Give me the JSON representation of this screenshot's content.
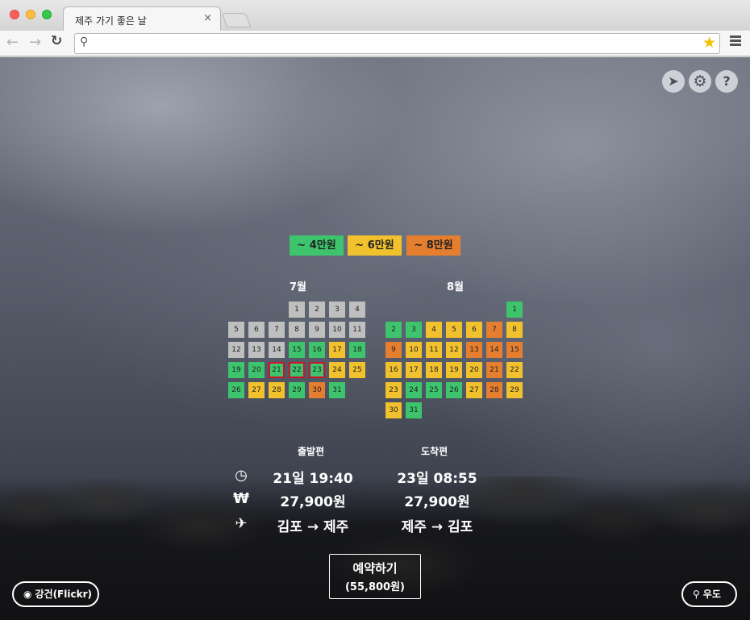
{
  "browser": {
    "tab_title": "제주 가기 좋은 날",
    "tab_close": "×",
    "address": ""
  },
  "legend": {
    "green": "~ 4만원",
    "yellow": "~ 6만원",
    "orange": "~ 8만원"
  },
  "colors": {
    "green": "#3ec46d",
    "yellow": "#f2c12e",
    "orange": "#e67e30",
    "gray": "#bfbfbf",
    "selected_border": "#d0112b"
  },
  "calendar": {
    "july": {
      "title": "7월",
      "days": [
        {
          "d": "1",
          "c": "gray"
        },
        {
          "d": "2",
          "c": "gray"
        },
        {
          "d": "3",
          "c": "gray"
        },
        {
          "d": "4",
          "c": "gray"
        },
        {
          "d": "5",
          "c": "gray"
        },
        {
          "d": "6",
          "c": "gray"
        },
        {
          "d": "7",
          "c": "gray"
        },
        {
          "d": "8",
          "c": "gray"
        },
        {
          "d": "9",
          "c": "gray"
        },
        {
          "d": "10",
          "c": "gray"
        },
        {
          "d": "11",
          "c": "gray"
        },
        {
          "d": "12",
          "c": "gray"
        },
        {
          "d": "13",
          "c": "gray"
        },
        {
          "d": "14",
          "c": "gray"
        },
        {
          "d": "15",
          "c": "green"
        },
        {
          "d": "16",
          "c": "green"
        },
        {
          "d": "17",
          "c": "yellow"
        },
        {
          "d": "18",
          "c": "green"
        },
        {
          "d": "19",
          "c": "green"
        },
        {
          "d": "20",
          "c": "green"
        },
        {
          "d": "21",
          "c": "green",
          "sel": true
        },
        {
          "d": "22",
          "c": "green",
          "sel": true
        },
        {
          "d": "23",
          "c": "green",
          "sel": true
        },
        {
          "d": "24",
          "c": "yellow"
        },
        {
          "d": "25",
          "c": "yellow"
        },
        {
          "d": "26",
          "c": "green"
        },
        {
          "d": "27",
          "c": "yellow"
        },
        {
          "d": "28",
          "c": "yellow"
        },
        {
          "d": "29",
          "c": "green"
        },
        {
          "d": "30",
          "c": "orange"
        },
        {
          "d": "31",
          "c": "green"
        }
      ]
    },
    "august": {
      "title": "8월",
      "days": [
        {
          "d": "1",
          "c": "green"
        },
        {
          "d": "2",
          "c": "green"
        },
        {
          "d": "3",
          "c": "green"
        },
        {
          "d": "4",
          "c": "yellow"
        },
        {
          "d": "5",
          "c": "yellow"
        },
        {
          "d": "6",
          "c": "yellow"
        },
        {
          "d": "7",
          "c": "orange"
        },
        {
          "d": "8",
          "c": "yellow"
        },
        {
          "d": "9",
          "c": "orange"
        },
        {
          "d": "10",
          "c": "yellow"
        },
        {
          "d": "11",
          "c": "yellow"
        },
        {
          "d": "12",
          "c": "yellow"
        },
        {
          "d": "13",
          "c": "orange"
        },
        {
          "d": "14",
          "c": "orange"
        },
        {
          "d": "15",
          "c": "orange"
        },
        {
          "d": "16",
          "c": "yellow"
        },
        {
          "d": "17",
          "c": "yellow"
        },
        {
          "d": "18",
          "c": "yellow"
        },
        {
          "d": "19",
          "c": "yellow"
        },
        {
          "d": "20",
          "c": "yellow"
        },
        {
          "d": "21",
          "c": "orange"
        },
        {
          "d": "22",
          "c": "yellow"
        },
        {
          "d": "23",
          "c": "yellow"
        },
        {
          "d": "24",
          "c": "green"
        },
        {
          "d": "25",
          "c": "green"
        },
        {
          "d": "26",
          "c": "green"
        },
        {
          "d": "27",
          "c": "yellow"
        },
        {
          "d": "28",
          "c": "orange"
        },
        {
          "d": "29",
          "c": "yellow"
        },
        {
          "d": "30",
          "c": "yellow"
        },
        {
          "d": "31",
          "c": "green"
        }
      ]
    }
  },
  "flight": {
    "departure_head": "출발편",
    "arrival_head": "도착편",
    "departure_time": "21일 19:40",
    "arrival_time": "23일 08:55",
    "departure_price": "27,900원",
    "arrival_price": "27,900원",
    "departure_route": "김포 → 제주",
    "arrival_route": "제주 → 김포"
  },
  "booking": {
    "label": "예약하기",
    "price": "(55,800원)"
  },
  "photo_credit": "강건(Flickr)",
  "weather": "우도",
  "icons": {
    "time": "clock-icon",
    "price": "won-icon",
    "route": "airplane-icon"
  }
}
